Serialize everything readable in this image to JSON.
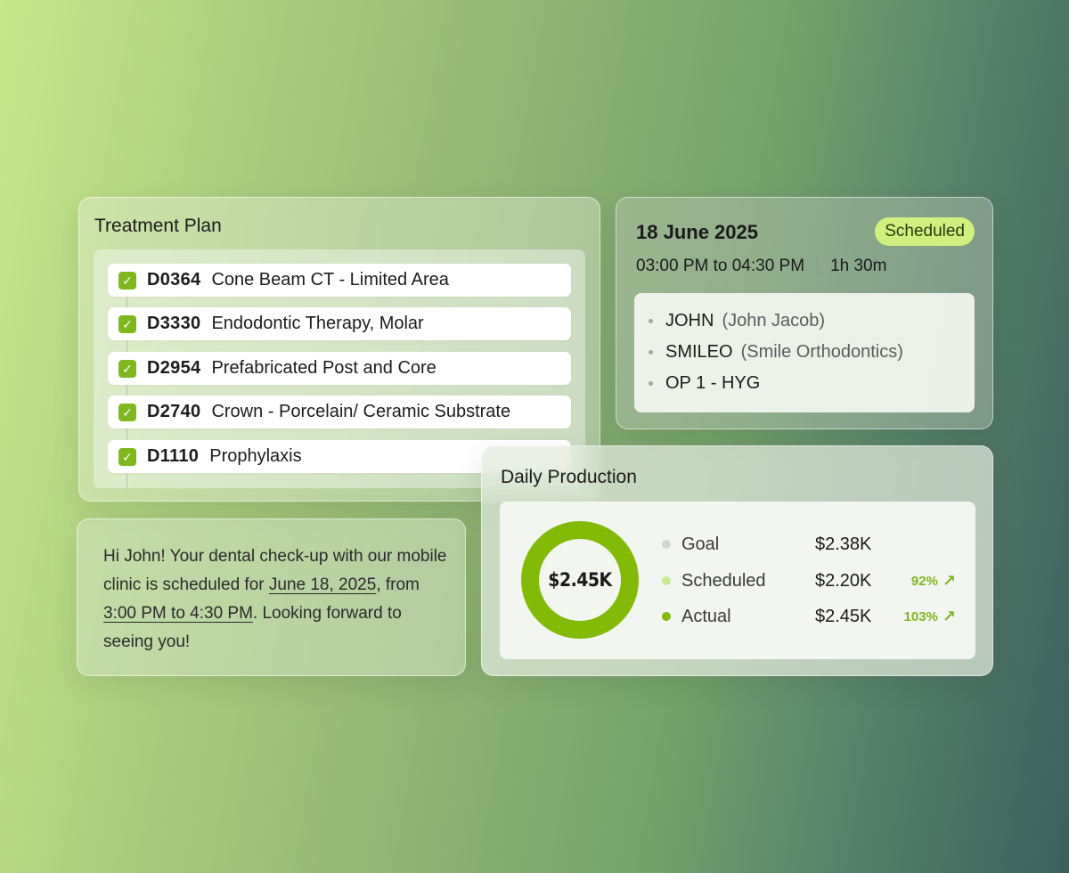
{
  "treatment_plan": {
    "title": "Treatment Plan",
    "items": [
      {
        "code": "D0364",
        "description": "Cone Beam CT - Limited Area",
        "checked": true
      },
      {
        "code": "D3330",
        "description": "Endodontic Therapy, Molar",
        "checked": true
      },
      {
        "code": "D2954",
        "description": "Prefabricated Post and Core",
        "checked": true
      },
      {
        "code": "D2740",
        "description": "Crown - Porcelain/ Ceramic Substrate",
        "checked": true
      },
      {
        "code": "D1110",
        "description": "Prophylaxis",
        "checked": true
      }
    ]
  },
  "appointment": {
    "date": "18 June 2025",
    "status": "Scheduled",
    "time_range": "03:00 PM to 04:30 PM",
    "duration": "1h 30m",
    "details": [
      {
        "main": "JOHN",
        "sub": "(John Jacob)"
      },
      {
        "main": "SMILEO",
        "sub": "(Smile Orthodontics)"
      },
      {
        "main": "OP 1 - HYG",
        "sub": ""
      }
    ]
  },
  "message": {
    "part1": "Hi John! Your dental check-up with our mobile clinic is scheduled for ",
    "date_link": "June 18, 2025",
    "part2": ", from ",
    "time_link": "3:00 PM to 4:30 PM",
    "part3": ". Looking forward to seeing you!"
  },
  "daily_production": {
    "title": "Daily Production",
    "center_value": "$2.45K",
    "rows": [
      {
        "label": "Goal",
        "value": "$2.38K",
        "percent": "",
        "dot_color": "#d3d5d0"
      },
      {
        "label": "Scheduled",
        "value": "$2.20K",
        "percent": "92%",
        "dot_color": "#c7ec8c"
      },
      {
        "label": "Actual",
        "value": "$2.45K",
        "percent": "103%",
        "dot_color": "#82bb06"
      }
    ]
  },
  "colors": {
    "accent_green": "#82bb06",
    "badge_bg": "#cff07c",
    "check_green": "#7fb81d"
  },
  "icons": {
    "check": "check-icon",
    "trend": "trend-up-icon"
  }
}
